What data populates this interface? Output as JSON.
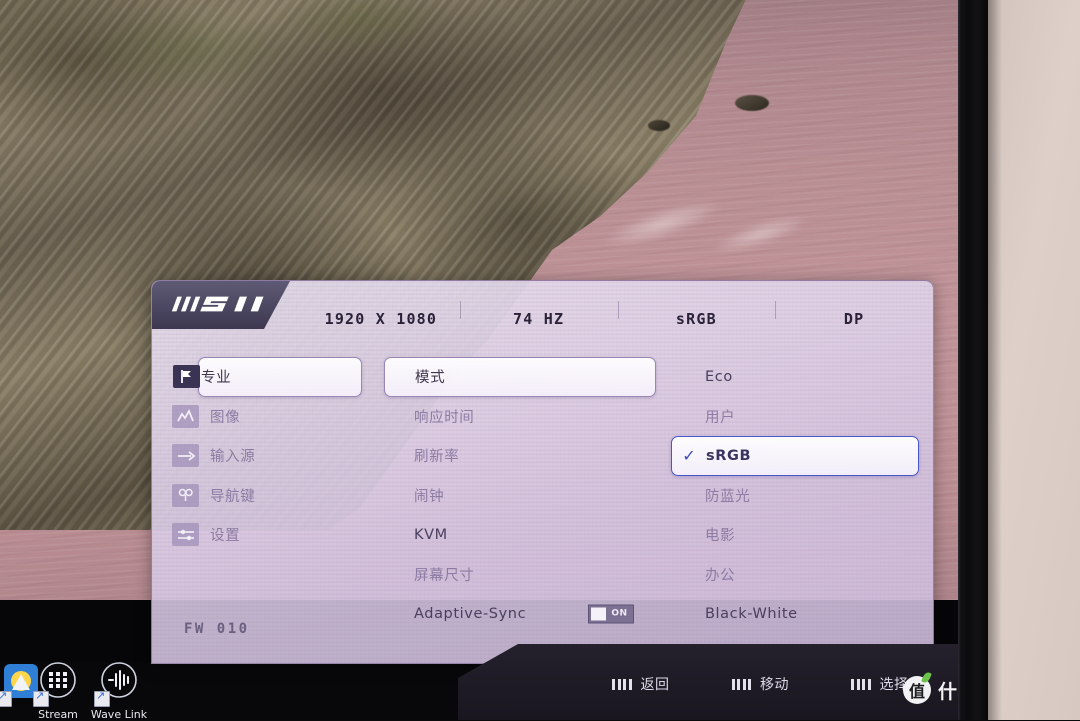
{
  "brand": {
    "logo_text": "MSI"
  },
  "header": {
    "items": [
      {
        "label": "1920 X 1080",
        "name": "resolution"
      },
      {
        "label": "74 HZ",
        "name": "refresh-rate"
      },
      {
        "label": "sRGB",
        "name": "color-mode"
      },
      {
        "label": "DP",
        "name": "input-source"
      }
    ]
  },
  "sidebar": {
    "items": [
      {
        "label": "专业",
        "icon": "pro-flag-icon",
        "selected": true
      },
      {
        "label": "图像",
        "icon": "image-mountain-icon",
        "selected": false
      },
      {
        "label": "输入源",
        "icon": "input-arrow-icon",
        "selected": false
      },
      {
        "label": "导航键",
        "icon": "navigation-joystick-icon",
        "selected": false
      },
      {
        "label": "设置",
        "icon": "settings-sliders-icon",
        "selected": false
      }
    ]
  },
  "middle": {
    "items": [
      {
        "label": "模式",
        "selected": true,
        "strong": false,
        "toggle": null
      },
      {
        "label": "响应时间",
        "selected": false,
        "strong": false,
        "toggle": null
      },
      {
        "label": "刷新率",
        "selected": false,
        "strong": false,
        "toggle": null
      },
      {
        "label": "闹钟",
        "selected": false,
        "strong": false,
        "toggle": null
      },
      {
        "label": "KVM",
        "selected": false,
        "strong": true,
        "toggle": null
      },
      {
        "label": "屏幕尺寸",
        "selected": false,
        "strong": false,
        "toggle": null
      },
      {
        "label": "Adaptive-Sync",
        "selected": false,
        "strong": true,
        "toggle": "ON"
      }
    ]
  },
  "right": {
    "items": [
      {
        "label": "Eco",
        "selected": false,
        "strong": false
      },
      {
        "label": "用户",
        "selected": false,
        "strong": false
      },
      {
        "label": "sRGB",
        "selected": true,
        "strong": true
      },
      {
        "label": "防蓝光",
        "selected": false,
        "strong": false
      },
      {
        "label": "电影",
        "selected": false,
        "strong": false
      },
      {
        "label": "办公",
        "selected": false,
        "strong": false
      },
      {
        "label": "Black-White",
        "selected": false,
        "strong": true
      }
    ],
    "check_glyph": "✓"
  },
  "firmware": {
    "label": "FW 010"
  },
  "navbar": {
    "items": [
      {
        "label": "返回",
        "icon": "four-bars-icon"
      },
      {
        "label": "移动",
        "icon": "four-bars-icon"
      },
      {
        "label": "选择",
        "icon": "four-bars-icon"
      }
    ]
  },
  "watermark": {
    "badge": "值",
    "text": "什么值得买"
  },
  "desktop": {
    "icons": [
      {
        "label": "Stream",
        "icon": "stream-deck-icon"
      },
      {
        "label": "Wave Link",
        "icon": "wave-link-icon"
      }
    ]
  },
  "colors": {
    "accent_blue": "#4a56c8",
    "osd_purple": "#8c7ba3",
    "msi_tab": "#3d3850",
    "toggle_on": "#7d7193"
  }
}
